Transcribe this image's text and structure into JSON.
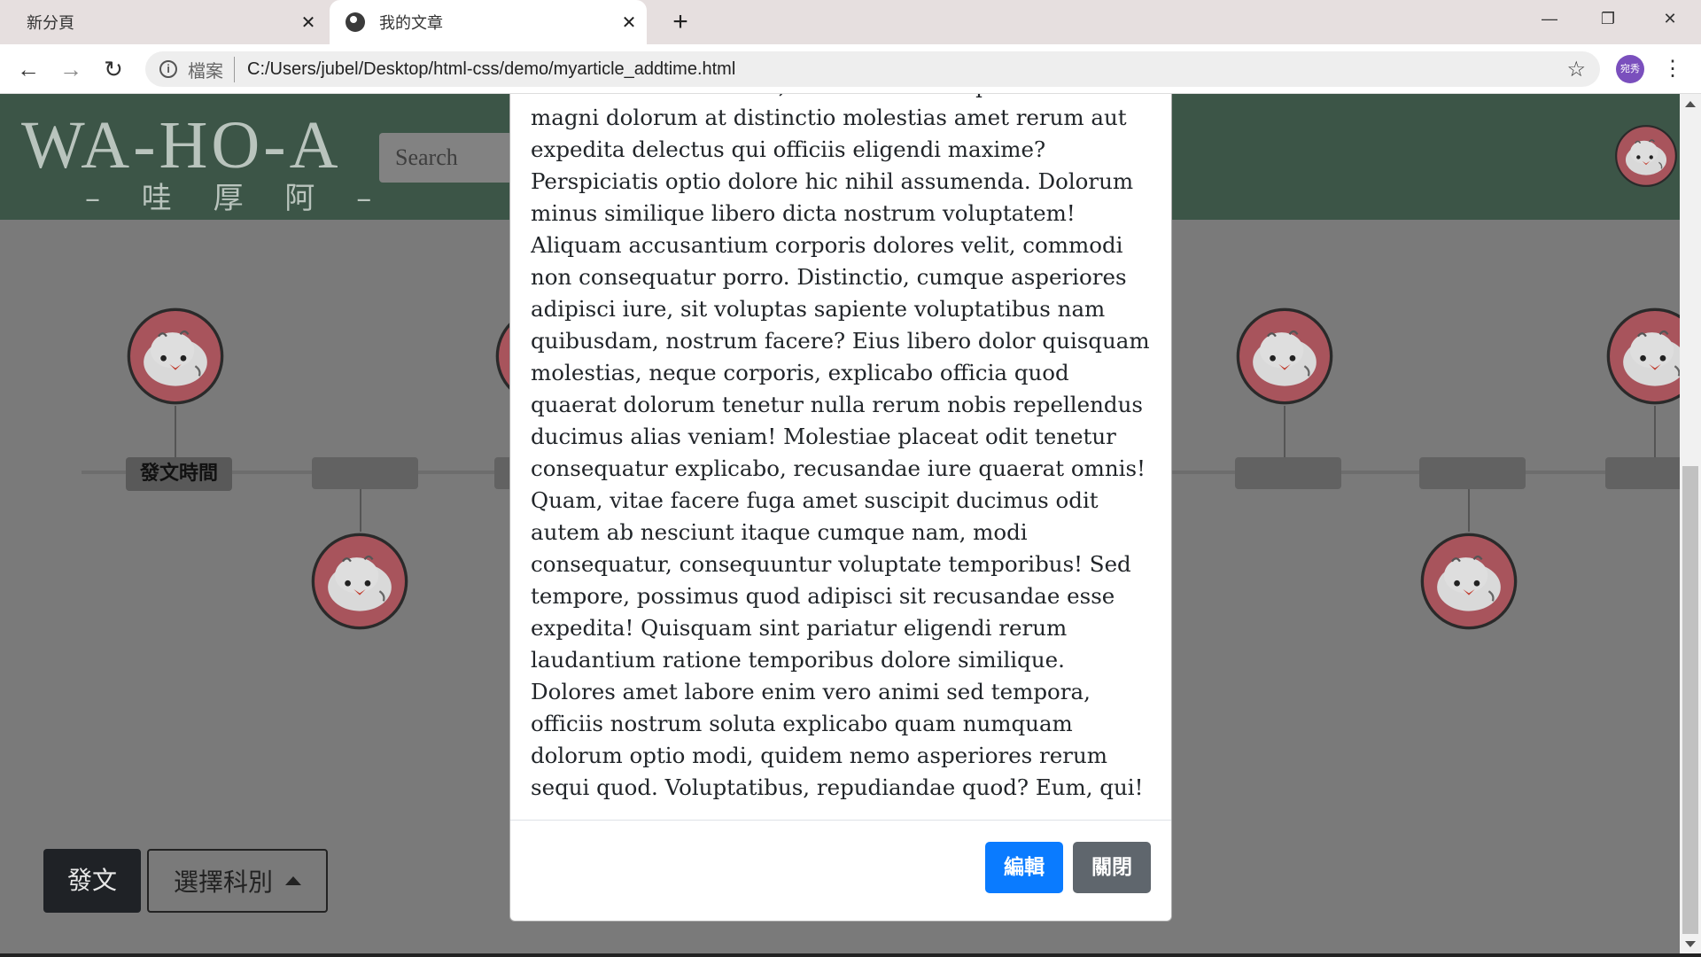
{
  "browser": {
    "tabs": [
      {
        "title": "新分頁",
        "active": false
      },
      {
        "title": "我的文章",
        "active": true
      }
    ],
    "address": {
      "scheme_label": "檔案",
      "url": "C:/Users/jubel/Desktop/html-css/demo/myarticle_addtime.html"
    },
    "profile_initials": "宛秀",
    "icons": {
      "back": "←",
      "forward": "→",
      "reload": "↻",
      "new_tab": "+",
      "close": "✕",
      "minimize": "—",
      "restore": "❐",
      "window_close": "✕",
      "star": "☆",
      "menu": "⋮",
      "info": "i"
    }
  },
  "header": {
    "logo_text": "WA-HO-A",
    "logo_sub": "– 哇 厚 阿 –",
    "search_placeholder": "Search"
  },
  "timeline": {
    "post_time_label": "發文時間"
  },
  "actions": {
    "post_label": "發文",
    "category_label": "選擇科別"
  },
  "modal": {
    "body_text": "odio sit eos nihil nemo, modi veniam itaque tenetur magni dolorum at distinctio molestias amet rerum aut expedita delectus qui officiis eligendi maxime? Perspiciatis optio dolore hic nihil assumenda. Dolorum minus similique libero dicta nostrum voluptatem! Aliquam accusantium corporis dolores velit, commodi non consequatur porro. Distinctio, cumque asperiores adipisci iure, sit voluptas sapiente voluptatibus nam quibusdam, nostrum facere? Eius libero dolor quisquam molestias, neque corporis, explicabo officia quod quaerat dolorum tenetur nulla rerum nobis repellendus ducimus alias veniam! Molestiae placeat odit tenetur consequatur explicabo, recusandae iure quaerat omnis! Quam, vitae facere fuga amet suscipit ducimus odit autem ab nesciunt itaque cumque nam, modi consequatur, consequuntur voluptate temporibus! Sed tempore, possimus quod adipisci sit recusandae esse expedita! Quisquam sint pariatur eligendi rerum laudantium ratione temporibus dolore similique. Dolores amet labore enim vero animi sed tempora, officiis nostrum soluta explicabo quam numquam dolorum optio modi, quidem nemo asperiores rerum sequi quod. Voluptatibus, repudiandae quod? Eum, qui!",
    "edit_label": "編輯",
    "close_label": "關閉"
  },
  "colors": {
    "header_bg": "#3c5547",
    "avatar_ring": "#b5616a",
    "primary_button": "#0a7bff",
    "secondary_button": "#5f666d"
  }
}
